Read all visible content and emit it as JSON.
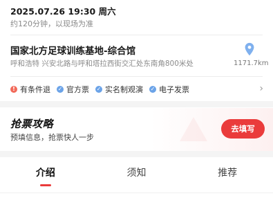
{
  "event": {
    "datetime": "2025.07.26 19:30 周六",
    "duration": "约120分钟，以现场为准"
  },
  "venue": {
    "name": "国家北方足球训练基地-综合馆",
    "address": "呼和浩特 兴安北路与呼和塔拉西街交汇处东南角800米处",
    "distance": "1171.7km",
    "pin_icon": "location-pin-icon"
  },
  "tags": [
    {
      "label": "有条件退",
      "icon": "info-icon",
      "color": "#f26a5a"
    },
    {
      "label": "官方票",
      "icon": "check-icon",
      "color": "#6ba3e8"
    },
    {
      "label": "实名制观演",
      "icon": "check-icon",
      "color": "#6ba3e8"
    },
    {
      "label": "电子发票",
      "icon": "check-icon",
      "color": "#6ba3e8"
    }
  ],
  "promo": {
    "title": "抢票攻略",
    "subtitle": "预填信息，抢票快人一步",
    "button": "去填写"
  },
  "tabs": [
    {
      "label": "介绍",
      "active": true
    },
    {
      "label": "须知",
      "active": false
    },
    {
      "label": "推荐",
      "active": false
    }
  ],
  "colors": {
    "accent": "#ea3b3b",
    "tag_blue": "#6ba3e8",
    "tag_red": "#f26a5a"
  }
}
